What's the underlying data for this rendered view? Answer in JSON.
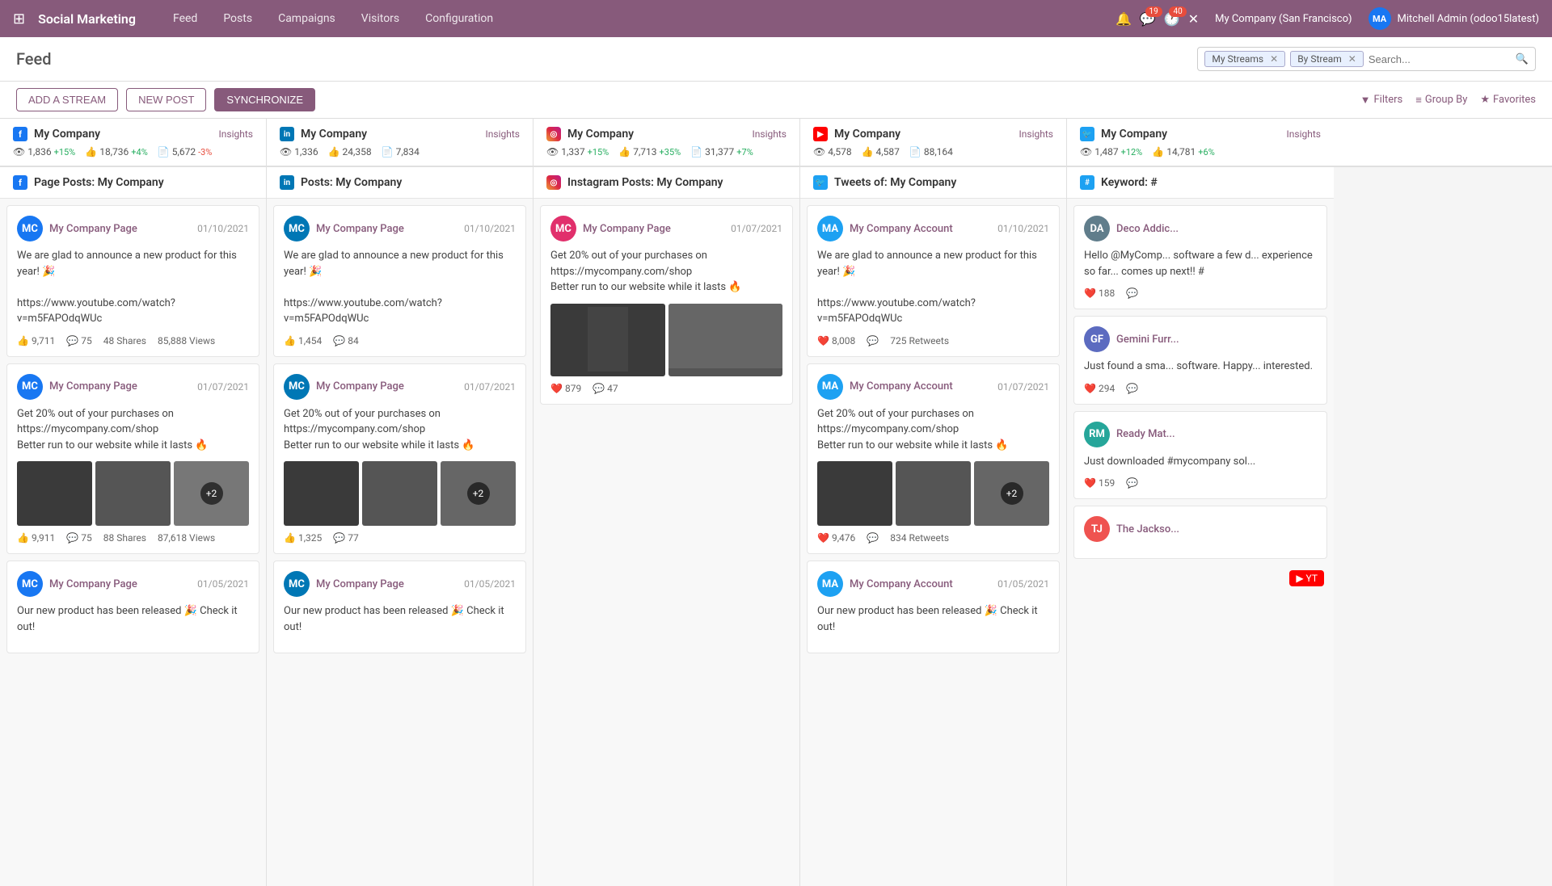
{
  "app": {
    "brand": "Social Marketing",
    "nav_items": [
      "Feed",
      "Posts",
      "Campaigns",
      "Visitors",
      "Configuration"
    ]
  },
  "nav": {
    "company": "My Company (San Francisco)",
    "user": "Mitchell Admin (odoo15latest)",
    "badge_messages": "19",
    "badge_activity": "40"
  },
  "page": {
    "title": "Feed"
  },
  "toolbar": {
    "add_stream": "ADD A STREAM",
    "new_post": "NEW POST",
    "synchronize": "SYNCHRONIZE",
    "filters": "Filters",
    "group_by": "Group By",
    "favorites": "Favorites"
  },
  "search": {
    "filters": [
      {
        "label": "My Streams",
        "id": "my-streams"
      },
      {
        "label": "By Stream",
        "id": "by-stream"
      }
    ],
    "placeholder": "Search..."
  },
  "streams": [
    {
      "id": "facebook",
      "platform": "facebook",
      "name": "My Company",
      "stats": [
        {
          "icon": "👁",
          "value": "1,836",
          "change": "+15%",
          "up": true
        },
        {
          "icon": "👍",
          "value": "18,736",
          "change": "+4%",
          "up": true
        },
        {
          "icon": "📄",
          "value": "5,672",
          "change": "-3%",
          "up": false
        }
      ],
      "col_title": "Page Posts: My Company"
    },
    {
      "id": "linkedin",
      "platform": "linkedin",
      "name": "My Company",
      "stats": [
        {
          "icon": "👁",
          "value": "1,336",
          "change": "",
          "up": true
        },
        {
          "icon": "👍",
          "value": "24,358",
          "change": "",
          "up": true
        },
        {
          "icon": "📄",
          "value": "7,834",
          "change": "",
          "up": true
        }
      ],
      "col_title": "Posts: My Company"
    },
    {
      "id": "instagram",
      "platform": "instagram",
      "name": "My Company",
      "stats": [
        {
          "icon": "👁",
          "value": "1,337",
          "change": "+15%",
          "up": true
        },
        {
          "icon": "👍",
          "value": "7,713",
          "change": "+35%",
          "up": true
        },
        {
          "icon": "📄",
          "value": "31,377",
          "change": "+7%",
          "up": true
        }
      ],
      "col_title": "Instagram Posts: My Company"
    },
    {
      "id": "youtube",
      "platform": "youtube",
      "name": "My Company",
      "stats": [
        {
          "icon": "👁",
          "value": "4,578",
          "change": "",
          "up": true
        },
        {
          "icon": "👍",
          "value": "4,587",
          "change": "",
          "up": true
        },
        {
          "icon": "📄",
          "value": "88,164",
          "change": "",
          "up": true
        }
      ],
      "col_title": "Tweets of: My Company"
    },
    {
      "id": "twitter",
      "platform": "twitter",
      "name": "My Company",
      "stats": [
        {
          "icon": "👁",
          "value": "1,487",
          "change": "+12%",
          "up": true
        },
        {
          "icon": "👍",
          "value": "14,781",
          "change": "+6%",
          "up": true
        }
      ],
      "col_title": "Keyword: #"
    }
  ],
  "posts": {
    "facebook": [
      {
        "author": "My Company Page",
        "date": "01/10/2021",
        "text": "We are glad to announce a new product for this year! 🎉\n\nhttps://www.youtube.com/watch?v=m5FAPOdqWUc",
        "likes": "9,711",
        "comments": "75",
        "shares": "48 Shares",
        "views": "85,888 Views",
        "has_images": false
      },
      {
        "author": "My Company Page",
        "date": "01/07/2021",
        "text": "Get 20% out of your purchases on https://mycompany.com/shop\nBetter run to our website while it lasts 🔥",
        "likes": "9,911",
        "comments": "75",
        "shares": "88 Shares",
        "views": "87,618 Views",
        "has_images": true
      },
      {
        "author": "My Company Page",
        "date": "01/05/2021",
        "text": "Our new product has been released 🎉 Check it out!",
        "likes": "",
        "comments": "",
        "shares": "",
        "views": "",
        "has_images": false
      }
    ],
    "linkedin": [
      {
        "author": "My Company Page",
        "date": "01/10/2021",
        "text": "We are glad to announce a new product for this year! 🎉\n\nhttps://www.youtube.com/watch?v=m5FAPOdqWUc",
        "likes": "1,454",
        "comments": "84",
        "has_images": false
      },
      {
        "author": "My Company Page",
        "date": "01/07/2021",
        "text": "Get 20% out of your purchases on https://mycompany.com/shop\nBetter run to our website while it lasts 🔥",
        "likes": "1,325",
        "comments": "77",
        "has_images": true
      },
      {
        "author": "My Company Page",
        "date": "01/05/2021",
        "text": "Our new product has been released 🎉 Check it out!",
        "likes": "",
        "comments": "",
        "has_images": false
      }
    ],
    "instagram": [
      {
        "author": "My Company Page",
        "date": "01/07/2021",
        "text": "Get 20% out of your purchases on https://mycompany.com/shop\nBetter run to our website while it lasts 🔥",
        "likes": "879",
        "comments": "47",
        "has_images": true
      }
    ],
    "youtube": [
      {
        "author": "My Company Account",
        "date": "01/10/2021",
        "text": "We are glad to announce a new product for this year! 🎉\n\nhttps://www.youtube.com/watch?v=m5FAPOdqWUc",
        "likes": "8,008",
        "comments": "",
        "retweets": "725 Retweets",
        "has_images": false
      },
      {
        "author": "My Company Account",
        "date": "01/07/2021",
        "text": "Get 20% out of your purchases on https://mycompany.com/shop\nBetter run to our website while it lasts 🔥",
        "likes": "9,476",
        "comments": "",
        "retweets": "834 Retweets",
        "has_images": true
      },
      {
        "author": "My Company Account",
        "date": "01/05/2021",
        "text": "Our new product has been released 🎉 Check it out!",
        "likes": "",
        "comments": "",
        "has_images": false
      }
    ],
    "twitter": [
      {
        "author": "Deco Addic...",
        "date": "",
        "text": "Hello @MyComp... software a few d... experience so far... comes up next!! #",
        "likes": "188",
        "comments": "",
        "has_images": false,
        "avatar_color": "#607d8b"
      },
      {
        "author": "Gemini Furr...",
        "date": "",
        "text": "Just found a sma... software. Happy... interested.",
        "likes": "294",
        "comments": "",
        "has_images": false,
        "avatar_color": "#5c6bc0"
      },
      {
        "author": "Ready Mat...",
        "date": "",
        "text": "Just downloaded #mycompany sol...",
        "likes": "159",
        "comments": "",
        "has_images": false,
        "avatar_color": "#26a69a"
      },
      {
        "author": "The Jackso...",
        "date": "",
        "text": "",
        "likes": "",
        "comments": "",
        "has_images": false,
        "avatar_color": "#ef5350"
      }
    ]
  },
  "insights_label": "Insights"
}
